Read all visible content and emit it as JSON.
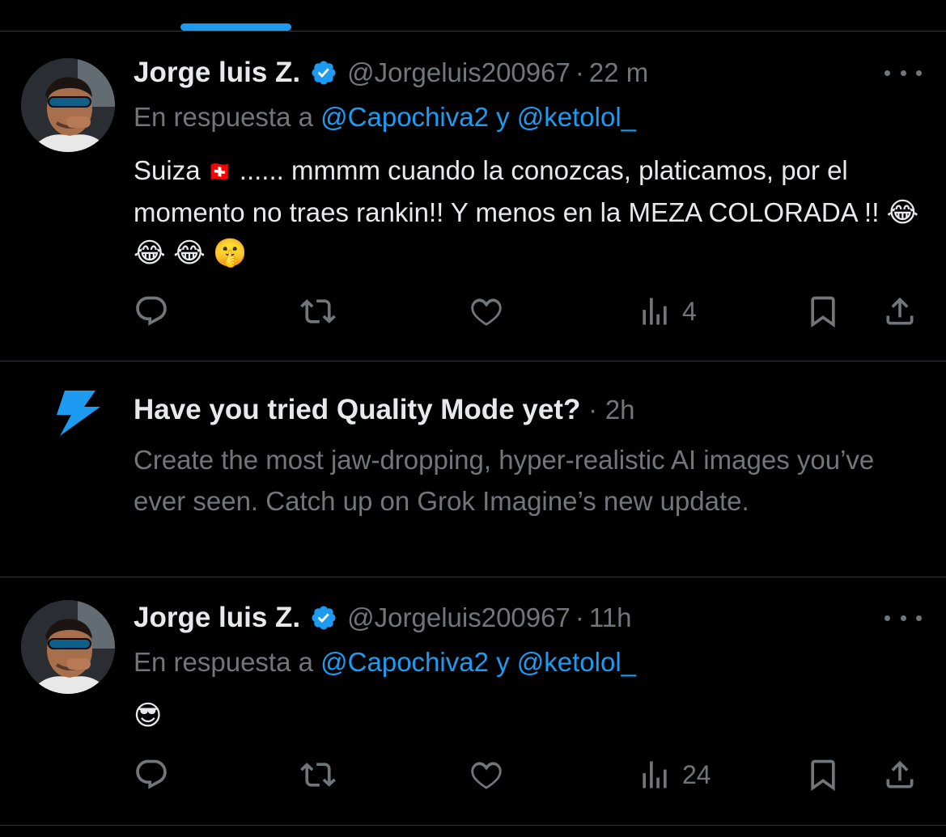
{
  "colors": {
    "background": "#000000",
    "text": "#e7e9ea",
    "muted": "#71767b",
    "accent": "#1d9bf0",
    "divider": "#2f3336"
  },
  "tweets": [
    {
      "author_name": "Jorge luis Z.",
      "handle": "@Jorgeluis200967",
      "separator": "·",
      "time": "22 m",
      "verified_icon": "verified-badge-icon",
      "reply_prefix": "En respuesta a",
      "mention_1": "@Capochiva2",
      "reply_conj": "y",
      "mention_2": "@ketolol_",
      "text_1": "Suiza",
      "flag_emoji": "🇨🇭",
      "text_2": "...... mmmm cuando la conozcas, platicamos, por el momento no traes rankin!! Y menos en la MEZA COLORADA !!",
      "emojis": "😂 😂 😂 🤫",
      "views": "4"
    },
    {
      "author_name": "Jorge luis Z.",
      "handle": "@Jorgeluis200967",
      "separator": "·",
      "time": "11h",
      "verified_icon": "verified-badge-icon",
      "reply_prefix": "En respuesta a",
      "mention_1": "@Capochiva2",
      "reply_conj": "y",
      "mention_2": "@ketolol_",
      "emojis": "😎",
      "views": "24"
    }
  ],
  "promo": {
    "icon": "lightning-bolt-icon",
    "title": "Have you tried Quality Mode yet?",
    "separator": "·",
    "time": "2h",
    "text": "Create the most jaw-dropping, hyper-realistic AI images you’ve ever seen. Catch up on Grok Imagine’s new update."
  },
  "action_icons": [
    "reply-icon",
    "retweet-icon",
    "like-icon",
    "views-icon",
    "bookmark-icon",
    "share-icon"
  ]
}
